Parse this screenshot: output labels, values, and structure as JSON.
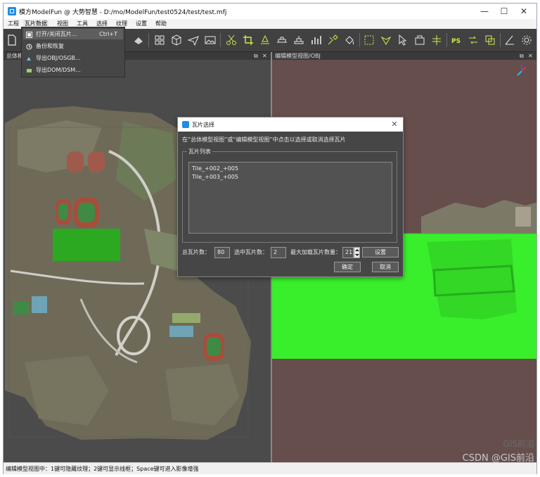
{
  "titlebar": {
    "title": "模方ModelFun @ 大势智慧 - D:/mo/ModelFun/test0524/test/test.mfj",
    "minimize": "—",
    "maximize": "☐",
    "close": "✕"
  },
  "menu": [
    "工程",
    "瓦片数据",
    "视图",
    "工具",
    "选择",
    "纹理",
    "设置",
    "帮助"
  ],
  "dropdown": {
    "items": [
      {
        "label": "打开/关闭瓦片...",
        "shortcut": "Ctrl+T",
        "icon": "open-tile-icon"
      },
      {
        "label": "备份和恢复",
        "shortcut": "",
        "icon": "backup-icon"
      },
      {
        "label": "导出OBJ/OSGB...",
        "shortcut": "",
        "icon": "export-obj-icon"
      },
      {
        "label": "导出DOM/DSM...",
        "shortcut": "",
        "icon": "export-dom-icon"
      }
    ]
  },
  "left_view": {
    "title": "总体模",
    "pin_icon": "⧉",
    "close_icon": "✕"
  },
  "right_view": {
    "title": "编辑模型视图/OBJ",
    "pin_icon": "⧉",
    "close_icon": "✕"
  },
  "dialog": {
    "title": "瓦片选择",
    "close": "✕",
    "instruction": "在“总体模型视图”或“编辑模型视图”中点击以选择或取消选择瓦片",
    "group_label": "瓦片列表",
    "tiles": [
      "Tile_+002_+005",
      "Tile_+003_+005"
    ],
    "total_label": "总瓦片数：",
    "total_value": "80",
    "selected_label": "选中瓦片数：",
    "selected_value": "2",
    "max_label": "最大加载瓦片数量：",
    "max_value": "21",
    "settings_button": "设置",
    "ok_button": "确定",
    "cancel_button": "取消"
  },
  "status": "编辑模型视图中：1键可隐藏纹理；2键可显示线框；Space键可进入影像增强",
  "watermark": "CSDN @GIS前沿",
  "watermark_brand": "GIS前沿",
  "colors": {
    "toolbar_bg": "#414141",
    "right_view_bg": "#664e4d",
    "tile_highlight": "#39ef2b",
    "accent": "#1e8ee0"
  }
}
